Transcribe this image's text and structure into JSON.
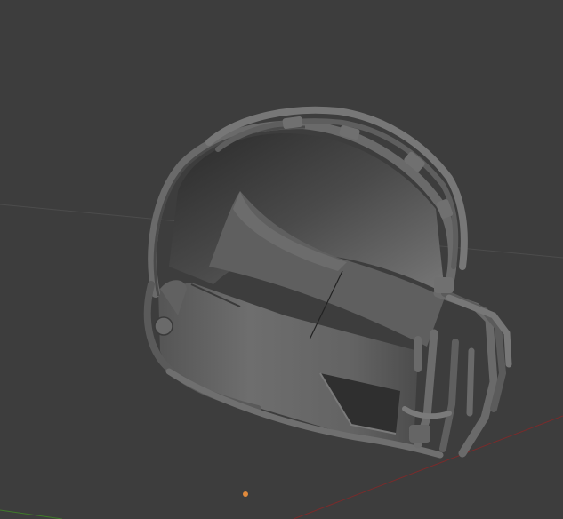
{
  "viewport": {
    "background": "#3d3d3d",
    "grid_color": "#4a4a4a",
    "axis_x_color": "#8a2e2e",
    "axis_y_color": "#3f7a2a",
    "origin_color": "#e08a3c"
  },
  "object": {
    "icon": "helmet-mesh-icon",
    "shade_dark": "#2c2c2c",
    "shade_mid": "#6a6a6a",
    "shade_light": "#8a8a8a"
  }
}
